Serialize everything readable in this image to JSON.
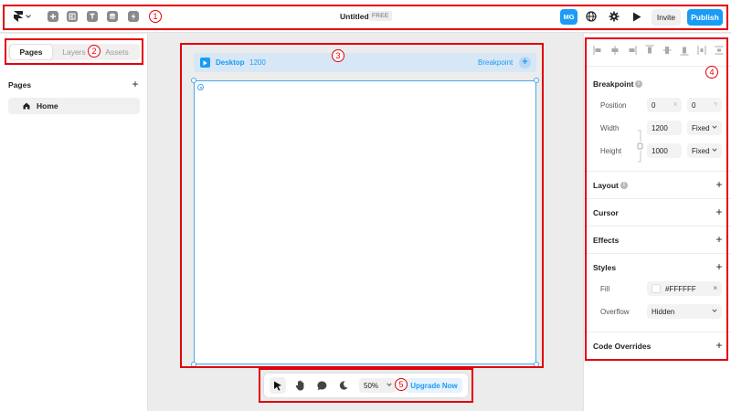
{
  "topbar": {
    "title": "Untitled",
    "plan_badge": "FREE",
    "avatar_initials": "MG",
    "invite_label": "Invite",
    "publish_label": "Publish"
  },
  "left_panel": {
    "tabs": [
      "Pages",
      "Layers",
      "Assets"
    ],
    "active_tab": "Pages",
    "pages_heading": "Pages",
    "add_symbol": "+",
    "pages": [
      {
        "label": "Home",
        "icon": "home-icon"
      }
    ]
  },
  "canvas": {
    "breakpoint_name": "Desktop",
    "breakpoint_width": "1200",
    "add_breakpoint_label": "Breakpoint",
    "add_symbol": "+"
  },
  "bottom_toolbar": {
    "tools": [
      "pointer-icon",
      "hand-icon",
      "comment-icon",
      "dark-mode-icon"
    ],
    "zoom": "50%",
    "upgrade_label": "Upgrade Now"
  },
  "right_panel": {
    "breakpoint_section": {
      "title": "Breakpoint",
      "position_label": "Position",
      "position_x": "0",
      "position_x_suffix": "X",
      "position_y": "0",
      "position_y_suffix": "Y",
      "width_label": "Width",
      "width_value": "1200",
      "width_mode": "Fixed",
      "height_label": "Height",
      "height_value": "1000",
      "height_mode": "Fixed"
    },
    "layout_title": "Layout",
    "cursor_title": "Cursor",
    "effects_title": "Effects",
    "styles_section": {
      "title": "Styles",
      "fill_label": "Fill",
      "fill_value": "#FFFFFF",
      "overflow_label": "Overflow",
      "overflow_value": "Hidden"
    },
    "code_overrides_title": "Code Overrides",
    "add_symbol": "+",
    "clear_symbol": "×"
  },
  "annotations": [
    "1",
    "2",
    "3",
    "4",
    "5"
  ],
  "colors": {
    "accent": "#1a9bf5",
    "annotation": "#e3000b",
    "breakpoint_bar": "#d8e7f5"
  }
}
